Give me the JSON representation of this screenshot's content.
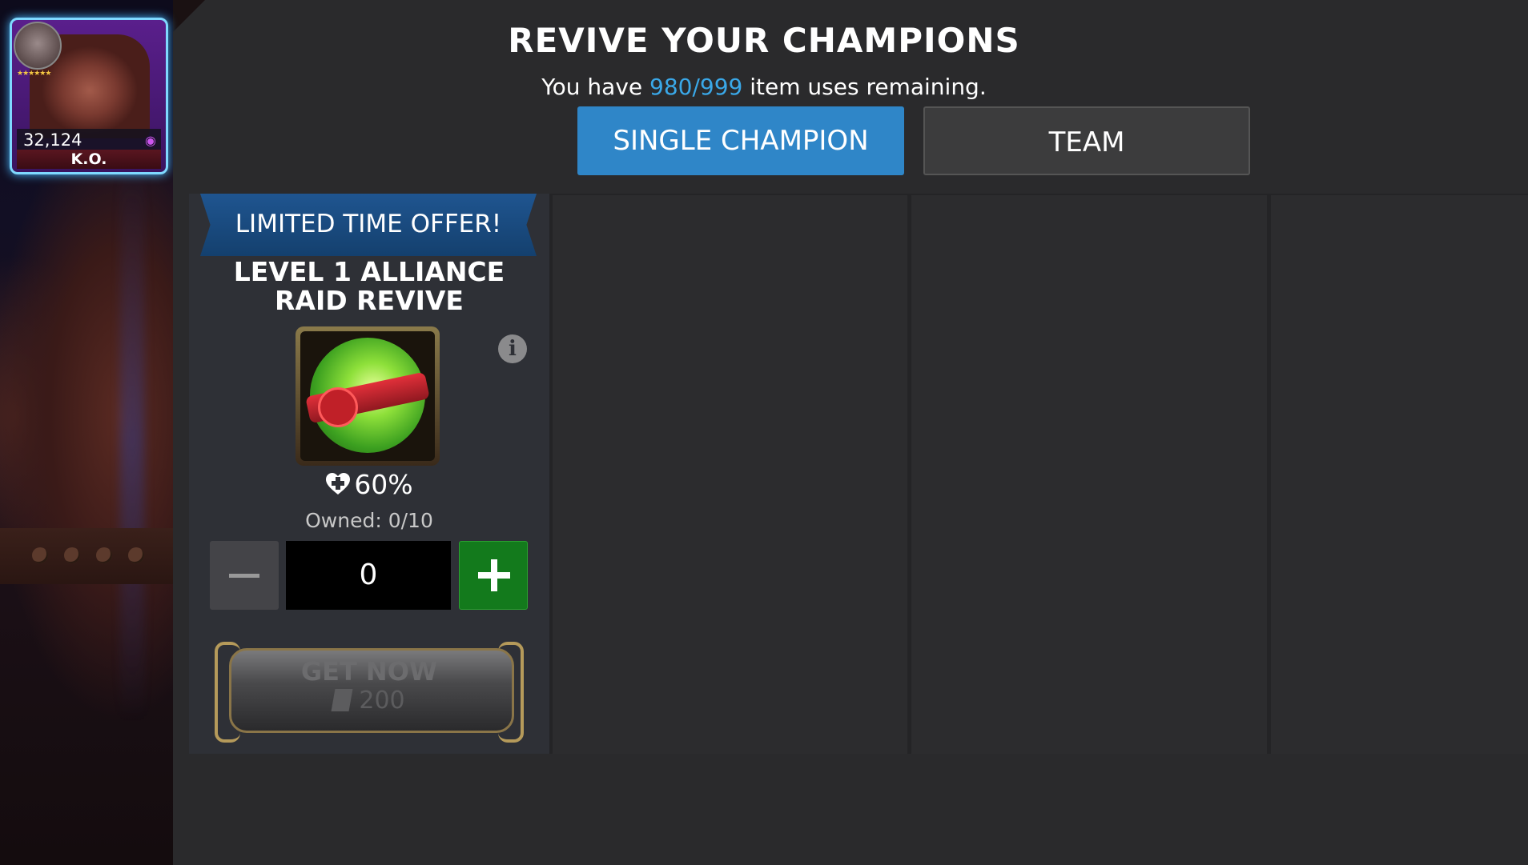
{
  "champion": {
    "rating": "32,124",
    "status": "K.O.",
    "stars": "★★★★★★",
    "class_icon": "mystic-class-icon"
  },
  "header": {
    "title": "REVIVE YOUR CHAMPIONS",
    "subtitle_prefix": "You have ",
    "uses": "980/999",
    "subtitle_suffix": " item uses remaining."
  },
  "tabs": {
    "single": "SINGLE CHAMPION",
    "team": "TEAM",
    "selected": "single"
  },
  "offer": {
    "banner": "LIMITED TIME OFFER!",
    "name_line1": "LEVEL 1 ALLIANCE",
    "name_line2": "RAID REVIVE",
    "heal": "60%",
    "owned": "Owned: 0/10",
    "quantity": "0",
    "button_label": "GET NOW",
    "price": "200"
  },
  "colors": {
    "accent_blue": "#3aa8e8",
    "tab_selected": "#2f86c8",
    "plus_green": "#137a1c"
  }
}
